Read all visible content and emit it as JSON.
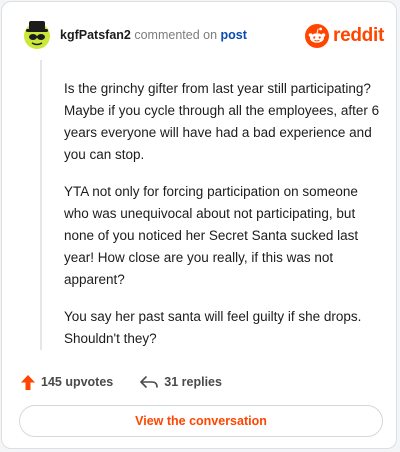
{
  "header": {
    "username": "kgfPatsfan2",
    "verb": "commented on",
    "post_link": "post",
    "logo_text": "reddit"
  },
  "comment": {
    "paragraphs": [
      "Is the grinchy gifter from last year still participating? Maybe if you cycle through all the employees, after 6 years everyone will have had a bad experience and you can stop.",
      "YTA not only for forcing participation on someone who was unequivocal about not participating, but none of you noticed her Secret Santa sucked last year! How close are you really, if this was not apparent?",
      "You say her past santa will feel guilty if she drops. Shouldn't they?"
    ]
  },
  "actions": {
    "upvotes": "145 upvotes",
    "replies": "31 replies"
  },
  "view_button": "View the conversation",
  "colors": {
    "brand": "#ff4500",
    "link": "#0a4bb3",
    "avatar_bg": "#c9e83a"
  },
  "icons": [
    "avatar-snoo-icon",
    "reddit-logo-icon",
    "upvote-arrow-icon",
    "reply-arrow-icon"
  ]
}
